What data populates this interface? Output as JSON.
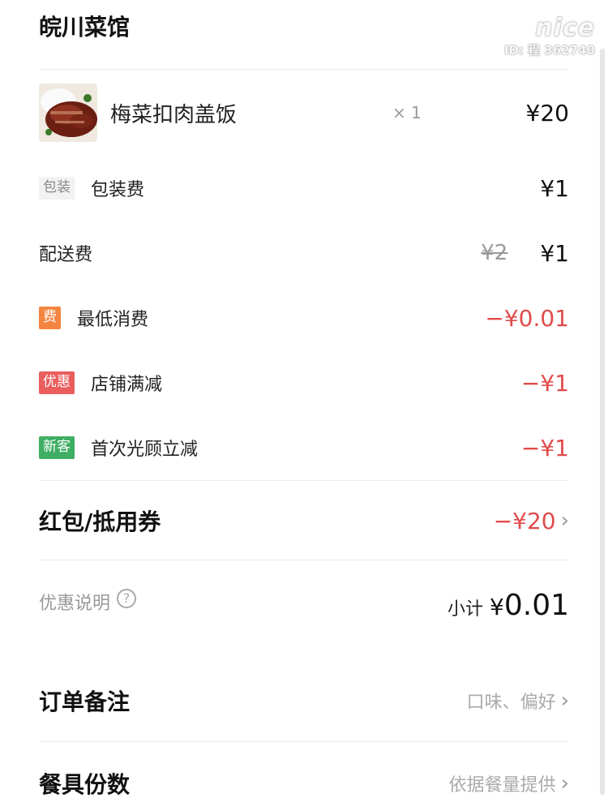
{
  "shop": {
    "name": "皖川菜馆"
  },
  "watermark": {
    "logo": "nice",
    "id": "ID: 程 362740"
  },
  "item": {
    "name": "梅菜扣肉盖饭",
    "qty": "× 1",
    "price": "¥20",
    "image_icon": "food-photo"
  },
  "fees": [
    {
      "tag": "包装",
      "label": "包装费",
      "price": "¥1",
      "tag_color": "#f2f2f2"
    },
    {
      "label": "配送费",
      "original": "¥2",
      "price": "¥1"
    },
    {
      "tag": "费",
      "label": "最低消费",
      "price": "−¥0.01",
      "tag_color": "#f38540"
    },
    {
      "tag": "优惠",
      "label": "店铺满减",
      "price": "−¥1",
      "tag_color": "#ea5e5e"
    },
    {
      "tag": "新客",
      "label": "首次光顾立减",
      "price": "−¥1",
      "tag_color": "#3eae63"
    }
  ],
  "coupon": {
    "label": "红包/抵用券",
    "value": "−¥20"
  },
  "discount_note": {
    "label": "优惠说明",
    "help_icon": "question-circle-icon"
  },
  "subtotal": {
    "label": "小计",
    "currency": "¥",
    "value": "0.01"
  },
  "order_note": {
    "label": "订单备注",
    "value": "口味、偏好"
  },
  "utensils": {
    "label": "餐具份数",
    "value": "依据餐量提供"
  },
  "colors": {
    "discount_red": "#e14b4b",
    "muted": "#999999"
  }
}
